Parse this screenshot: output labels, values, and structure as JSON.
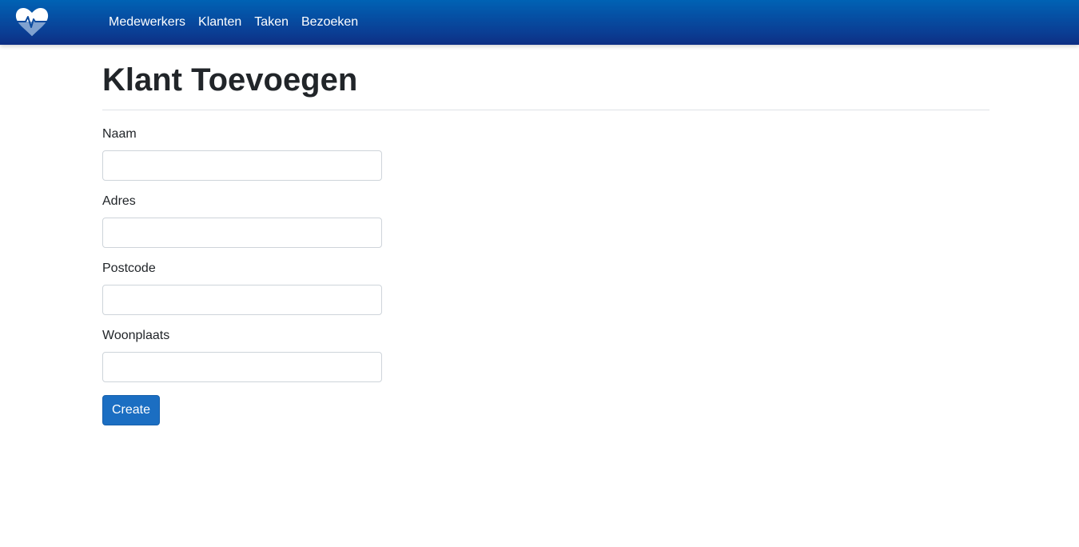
{
  "navbar": {
    "logo_icon": "heart-pulse-icon",
    "links": [
      {
        "label": "Medewerkers"
      },
      {
        "label": "Klanten"
      },
      {
        "label": "Taken"
      },
      {
        "label": "Bezoeken"
      }
    ]
  },
  "page": {
    "title": "Klant Toevoegen"
  },
  "form": {
    "fields": [
      {
        "label": "Naam",
        "value": "",
        "placeholder": ""
      },
      {
        "label": "Adres",
        "value": "",
        "placeholder": ""
      },
      {
        "label": "Postcode",
        "value": "",
        "placeholder": ""
      },
      {
        "label": "Woonplaats",
        "value": "",
        "placeholder": ""
      }
    ],
    "submit_label": "Create"
  },
  "colors": {
    "navbar_top": "#0062b4",
    "navbar_bottom": "#0d2f84",
    "button_primary": "#1b6ec2"
  }
}
